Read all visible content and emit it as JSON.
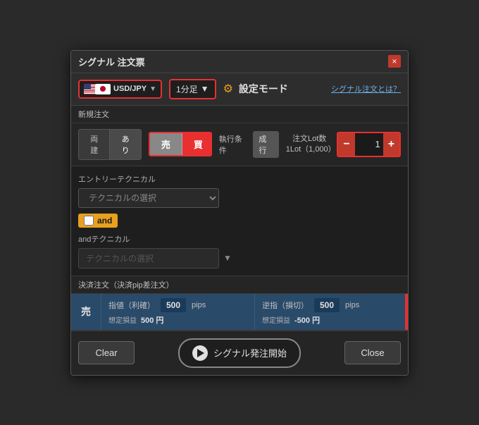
{
  "dialog": {
    "title": "シグナル 注文票",
    "close_label": "×"
  },
  "instrument": {
    "name": "USD/JPY",
    "timeframe": "1分足",
    "dropdown_arrow": "▼"
  },
  "mode": {
    "icon": "⚙",
    "label": "設定モード",
    "help_link": "シグナル注文とは？"
  },
  "new_order": {
    "section_label": "新規注文",
    "both_tab": "両建",
    "yes_tab": "あり",
    "sell_label": "売",
    "buy_label": "買",
    "execution_label": "執行条件",
    "execution_value": "成行",
    "lot_label_line1": "注文Lot数",
    "lot_label_line2": "1Lot（1,000）",
    "lot_value": "1",
    "minus_label": "−",
    "plus_label": "+"
  },
  "technical": {
    "entry_label": "エントリーテクニカル",
    "select_placeholder": "テクニカルの選択",
    "and_label": "and",
    "and_technical_label": "andテクニカル",
    "and_select_placeholder": "テクニカルの選択"
  },
  "settlement": {
    "section_label": "決済注文（決済pip差注文）",
    "side_label": "売",
    "limit_label": "指値（利確）",
    "limit_value": "500",
    "limit_unit": "pips",
    "limit_pnl_label": "想定損益",
    "limit_pnl_value": "500 円",
    "stop_label": "逆指（損切）",
    "stop_value": "500",
    "stop_unit": "pips",
    "stop_pnl_label": "想定損益",
    "stop_pnl_value": "-500 円"
  },
  "bottom": {
    "clear_label": "Clear",
    "start_label": "シグナル発注開始",
    "close_label": "Close"
  }
}
